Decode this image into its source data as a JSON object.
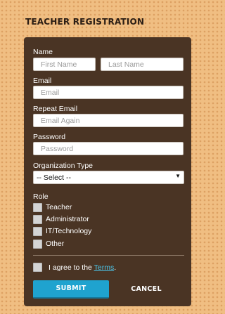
{
  "page": {
    "title": "TEACHER REGISTRATION"
  },
  "form": {
    "name_label": "Name",
    "first_name_placeholder": "First Name",
    "last_name_placeholder": "Last Name",
    "email_label": "Email",
    "email_placeholder": "Email",
    "repeat_email_label": "Repeat Email",
    "repeat_email_placeholder": "Email Again",
    "password_label": "Password",
    "password_placeholder": "Password",
    "org_type_label": "Organization Type",
    "org_type_selected": "-- Select --",
    "role_label": "Role",
    "roles": [
      {
        "label": "Teacher",
        "checked": false
      },
      {
        "label": "Administrator",
        "checked": false
      },
      {
        "label": "IT/Technology",
        "checked": false
      },
      {
        "label": "Other",
        "checked": false
      }
    ],
    "terms_prefix": "I agree to the ",
    "terms_link": "Terms",
    "terms_suffix": ".",
    "submit_label": "SUBMIT",
    "cancel_label": "CANCEL"
  },
  "colors": {
    "background": "#f0be82",
    "panel": "#4a3424",
    "submit_button": "#1fa3cf",
    "link": "#4cc3e6"
  },
  "icons": {
    "select_arrow": "dropdown-arrow-icon"
  }
}
